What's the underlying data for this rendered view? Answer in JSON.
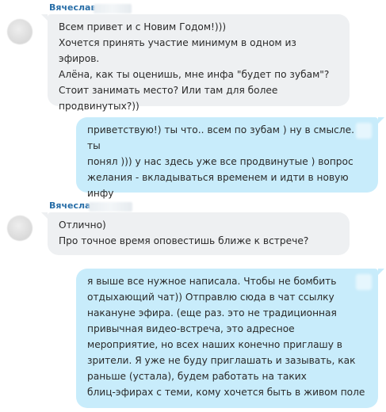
{
  "messages": [
    {
      "sender": "Вячеслав",
      "direction": "incoming",
      "text": "Всем привет и с Новим Годом!)))\nХочется принять участие минимум в одном из эфиров.\nАлёна, как ты оценишь, мне инфа \"будет по зубам\"?\nСтоит занимать место? Или там для более\nпродвинутых?))"
    },
    {
      "direction": "outgoing",
      "text": "приветствую!) ты что.. всем по зубам ) ну в смысле. ты\nпонял ))) у нас здесь уже все продвинутые )  вопрос\nжелания  - вкладываться временем и идти в новую\nинфу"
    },
    {
      "sender": "Вячеслав",
      "direction": "incoming",
      "text": "Отлично)\nПро точное время оповестишь ближе к встрече?"
    },
    {
      "direction": "outgoing",
      "text": "я выше все нужное написала. Чтобы не бомбить\nотдыхающий чат)) Отправлю сюда в чат ссылку\nнакануне эфира. (еще раз. это не традиционная\nпривычная видео-встреча, это адресное\nмероприятие, но всех наших конечно приглашу в\nзрители. Я уже не буду приглашать и зазывать, как\nраньше (устала), будем работать на таких\nблиц-эфирах с теми, кому хочется быть в живом поле"
    }
  ],
  "colors": {
    "incoming_bubble": "#eef0f2",
    "outgoing_bubble": "#c8ecfb",
    "sender_name": "#2a6fa8"
  }
}
